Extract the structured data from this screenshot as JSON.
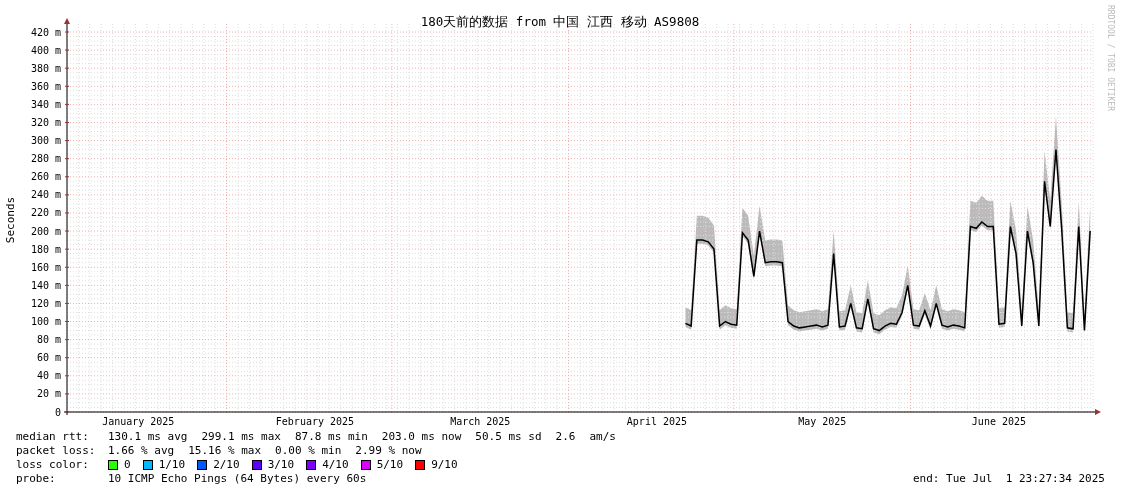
{
  "chart": {
    "side_text": "RRDTOOL / TOBI OETIKER",
    "chart_data": {
      "type": "line",
      "title": "180天前的数据 from 中国 江西 移动 AS9808",
      "ylabel": "Seconds",
      "ylim": [
        0,
        420
      ],
      "grid": true,
      "categories": [
        null,
        null,
        null,
        null,
        null,
        null,
        null,
        null,
        null,
        null,
        null,
        null,
        "January 2025",
        null,
        null,
        null,
        null,
        null,
        null,
        null,
        null,
        null,
        null,
        null,
        null,
        null,
        null,
        null,
        null,
        null,
        null,
        null,
        null,
        null,
        null,
        null,
        null,
        null,
        null,
        null,
        null,
        null,
        null,
        "February 2025",
        null,
        null,
        null,
        null,
        null,
        null,
        null,
        null,
        null,
        null,
        null,
        null,
        null,
        null,
        null,
        null,
        null,
        null,
        null,
        null,
        null,
        null,
        null,
        null,
        null,
        null,
        null,
        null,
        "March 2025",
        null,
        null,
        null,
        null,
        null,
        null,
        null,
        null,
        null,
        null,
        null,
        null,
        null,
        null,
        null,
        null,
        null,
        null,
        null,
        null,
        null,
        null,
        null,
        null,
        null,
        null,
        null,
        null,
        null,
        null,
        "April 2025",
        null,
        null,
        null,
        null,
        null,
        null,
        null,
        null,
        null,
        null,
        null,
        null,
        null,
        null,
        null,
        null,
        null,
        null,
        null,
        null,
        null,
        null,
        null,
        null,
        null,
        null,
        null,
        null,
        "May 2025",
        null,
        null,
        null,
        null,
        null,
        null,
        null,
        null,
        null,
        null,
        null,
        null,
        null,
        null,
        null,
        null,
        null,
        null,
        null,
        null,
        null,
        null,
        null,
        null,
        null,
        null,
        null,
        null,
        null,
        null,
        "June 2025",
        null,
        null,
        null,
        null,
        null,
        null,
        null,
        null,
        null,
        null,
        null,
        null,
        null,
        null,
        null,
        null
      ],
      "series": [
        {
          "color": "#000000",
          "values": [
            null,
            null,
            null,
            null,
            null,
            null,
            null,
            null,
            null,
            null,
            null,
            null,
            null,
            null,
            null,
            null,
            null,
            null,
            null,
            null,
            null,
            null,
            null,
            null,
            null,
            null,
            null,
            null,
            null,
            null,
            null,
            null,
            null,
            null,
            null,
            null,
            null,
            null,
            null,
            null,
            null,
            null,
            null,
            null,
            null,
            null,
            null,
            null,
            null,
            null,
            null,
            null,
            null,
            null,
            null,
            null,
            null,
            null,
            null,
            null,
            null,
            null,
            null,
            null,
            null,
            null,
            null,
            null,
            null,
            null,
            null,
            null,
            null,
            null,
            null,
            null,
            null,
            null,
            null,
            null,
            null,
            null,
            null,
            null,
            null,
            null,
            null,
            null,
            null,
            null,
            null,
            null,
            null,
            null,
            null,
            null,
            null,
            null,
            null,
            null,
            null,
            null,
            null,
            null,
            null,
            null,
            null,
            null,
            98,
            95,
            190,
            190,
            188,
            180,
            95,
            100,
            97,
            96,
            198,
            190,
            150,
            200,
            165,
            166,
            166,
            165,
            100,
            95,
            93,
            94,
            95,
            96,
            94,
            96,
            175,
            94,
            95,
            120,
            93,
            92,
            125,
            92,
            90,
            95,
            98,
            97,
            110,
            140,
            96,
            95,
            112,
            95,
            120,
            96,
            94,
            96,
            95,
            93,
            205,
            203,
            210,
            205,
            205,
            97,
            98,
            205,
            175,
            95,
            200,
            165,
            95,
            255,
            205,
            290,
            203,
            93,
            92,
            205,
            90,
            200
          ]
        }
      ],
      "yticks": [
        {
          "value": 0,
          "label": "0"
        },
        {
          "value": 20,
          "label": "20 m"
        },
        {
          "value": 40,
          "label": "40 m"
        },
        {
          "value": 60,
          "label": "60 m"
        },
        {
          "value": 80,
          "label": "80 m"
        },
        {
          "value": 100,
          "label": "100 m"
        },
        {
          "value": 120,
          "label": "120 m"
        },
        {
          "value": 140,
          "label": "140 m"
        },
        {
          "value": 160,
          "label": "160 m"
        },
        {
          "value": 180,
          "label": "180 m"
        },
        {
          "value": 200,
          "label": "200 m"
        },
        {
          "value": 220,
          "label": "220 m"
        },
        {
          "value": 240,
          "label": "240 m"
        },
        {
          "value": 260,
          "label": "260 m"
        },
        {
          "value": 280,
          "label": "280 m"
        },
        {
          "value": 300,
          "label": "300 m"
        },
        {
          "value": 320,
          "label": "320 m"
        },
        {
          "value": 340,
          "label": "340 m"
        },
        {
          "value": 360,
          "label": "360 m"
        },
        {
          "value": 380,
          "label": "380 m"
        },
        {
          "value": 400,
          "label": "400 m"
        },
        {
          "value": 420,
          "label": "420 m"
        }
      ]
    }
  },
  "stats": [
    {
      "label": "median rtt:",
      "items": [
        "130.1 ms avg",
        "299.1 ms max",
        "87.8 ms min",
        "203.0 ms now",
        "50.5 ms sd",
        "2.6",
        "am/s"
      ]
    },
    {
      "label": "packet loss:",
      "items": [
        "1.66 % avg",
        "15.16 % max",
        "0.00 % min",
        "2.99 % now"
      ]
    }
  ],
  "loss_legend": {
    "label": "loss color:",
    "entries": [
      {
        "label": "0",
        "color": "#26ff00"
      },
      {
        "label": "1/10",
        "color": "#00b8ff"
      },
      {
        "label": "2/10",
        "color": "#0059ff"
      },
      {
        "label": "3/10",
        "color": "#5e00ff"
      },
      {
        "label": "4/10",
        "color": "#7e00ff"
      },
      {
        "label": "5/10",
        "color": "#dd00ff"
      },
      {
        "label": "9/10",
        "color": "#ff0000"
      }
    ]
  },
  "probe": {
    "label": "probe:",
    "text": "10 ICMP Echo Pings (64 Bytes) every 60s",
    "end": "end: Tue Jul  1 23:27:34 2025"
  }
}
